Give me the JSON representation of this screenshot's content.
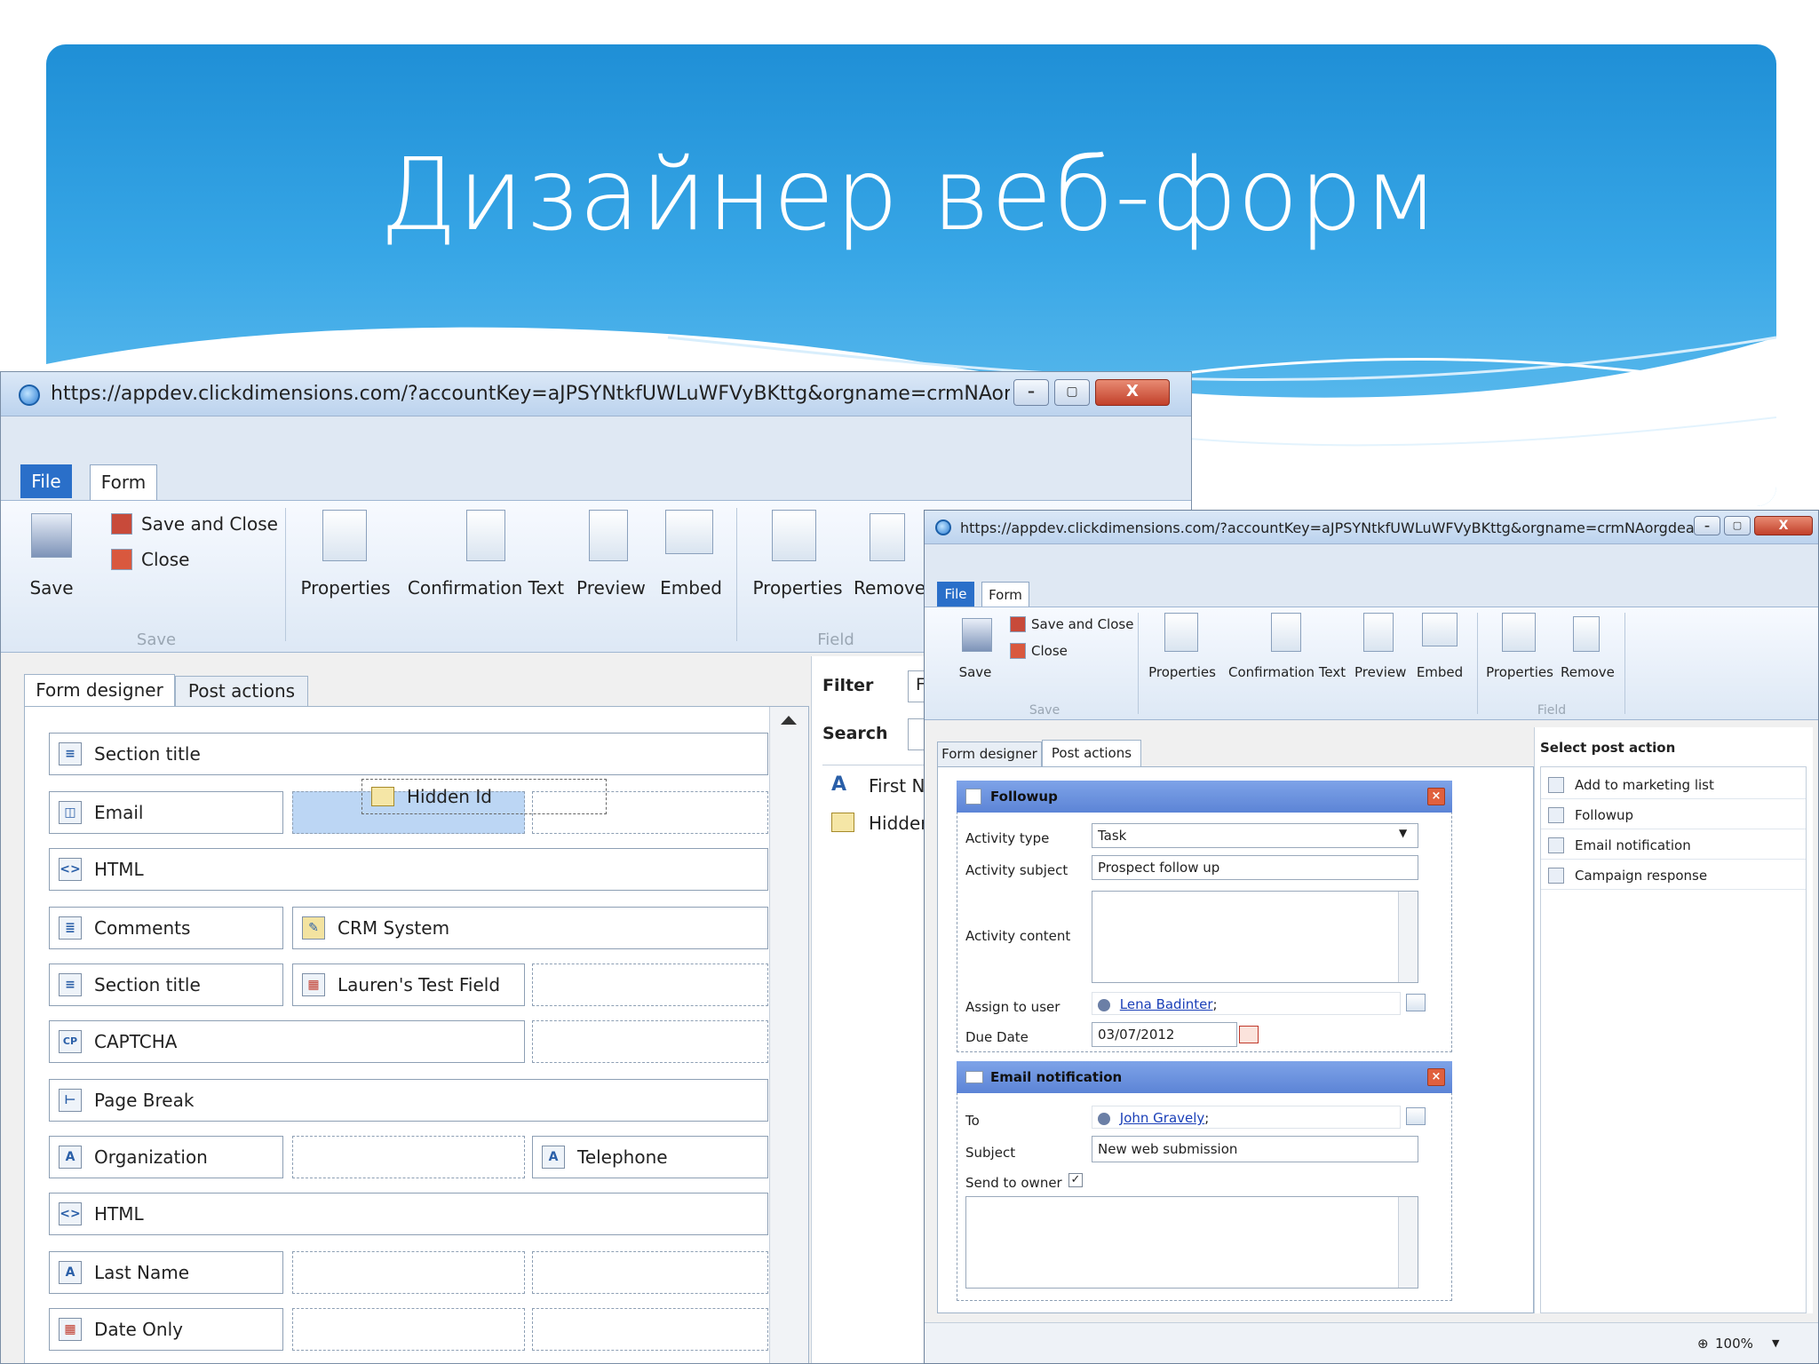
{
  "slide": {
    "title": "Дизайнер веб-форм"
  },
  "back_window": {
    "url": "https://appdev.clickdimensions.com/?accountKey=aJPSYNtkfUWLuWFVyBKttg&orgname=crmNAorgdeadc...",
    "tabs": {
      "file": "File",
      "form": "Form"
    },
    "ribbon": {
      "save": "Save",
      "save_and_close": "Save and Close",
      "close": "Close",
      "properties": "Properties",
      "confirmation_text": "Confirmation Text",
      "preview": "Preview",
      "embed": "Embed",
      "field_properties": "Properties",
      "remove": "Remove",
      "group_save": "Save",
      "group_field": "Field"
    },
    "content_tabs": {
      "form_designer": "Form designer",
      "post_actions": "Post actions"
    },
    "fields": {
      "section_title_1": "Section title",
      "email": "Email",
      "hidden_id": "Hidden Id",
      "html_1": "HTML",
      "comments": "Comments",
      "crm_system": "CRM System",
      "section_title_2": "Section title",
      "laurens_test_field": "Lauren's Test Field",
      "captcha": "CAPTCHA",
      "page_break": "Page Break",
      "organization": "Organization",
      "telephone": "Telephone",
      "html_2": "HTML",
      "last_name": "Last Name",
      "date_only": "Date Only"
    },
    "side": {
      "filter_label": "Filter",
      "filter_value": "F",
      "search_label": "Search",
      "item1": "First N",
      "item2": "Hidder"
    }
  },
  "front_window": {
    "url": "https://appdev.clickdimensions.com/?accountKey=aJPSYNtkfUWLuWFVyBKttg&orgname=crmNAorgdeadc...",
    "tabs": {
      "file": "File",
      "form": "Form"
    },
    "ribbon": {
      "save": "Save",
      "save_and_close": "Save and Close",
      "close": "Close",
      "properties": "Properties",
      "confirmation_text": "Confirmation Text",
      "preview": "Preview",
      "embed": "Embed",
      "field_properties": "Properties",
      "remove": "Remove",
      "group_save": "Save",
      "group_field": "Field"
    },
    "content_tabs": {
      "form_designer": "Form designer",
      "post_actions": "Post actions"
    },
    "followup": {
      "title": "Followup",
      "activity_type_label": "Activity type",
      "activity_type_value": "Task",
      "activity_subject_label": "Activity subject",
      "activity_subject_value": "Prospect follow up",
      "activity_content_label": "Activity content",
      "assign_to_user_label": "Assign to user",
      "assign_to_user_value": "Lena Badinter",
      "due_date_label": "Due Date",
      "due_date_value": "03/07/2012"
    },
    "email_notification": {
      "title": "Email notification",
      "to_label": "To",
      "to_value": "John Gravely",
      "subject_label": "Subject",
      "subject_value": "New web submission",
      "send_to_owner_label": "Send to owner"
    },
    "select_post_action": {
      "title": "Select post action",
      "items": [
        "Add to marketing list",
        "Followup",
        "Email notification",
        "Campaign response"
      ]
    },
    "status": {
      "zoom": "100%"
    }
  }
}
